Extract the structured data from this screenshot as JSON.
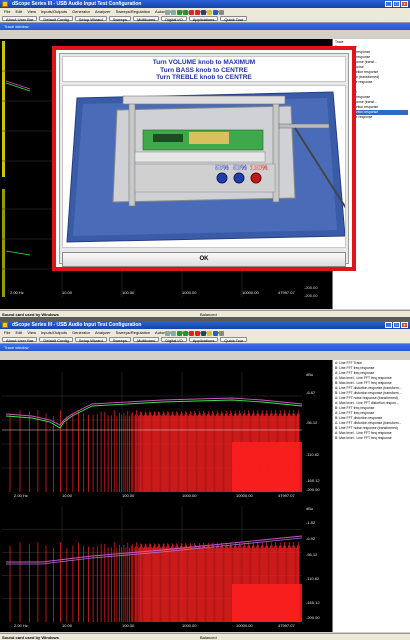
{
  "window_title": "dScope Series III - USB Audio Input Test Configuration",
  "menu": [
    "File",
    "Edit",
    "View",
    "Inputs/Outputs",
    "Generator",
    "Analyzer",
    "Sweeps/Regulation",
    "Automation",
    "Utility",
    "Window",
    "Help"
  ],
  "toolbar_buttons": [
    "About User Bar",
    "Default Config",
    "Setup Wizard",
    "Sweeps",
    "Multitones",
    "Digital I/O",
    "Applications",
    "Quick Tour"
  ],
  "trace_window_title": "Trace window",
  "dialog": {
    "instructions": [
      "Turn VOLUME knob to MAXIMUM",
      "Turn BASS knob to CENTRE",
      "Turn TREBLE knob to CENTRE"
    ],
    "knob_labels": [
      "50%",
      "50%",
      "100%"
    ],
    "ok_label": "OK"
  },
  "status_text": "Sound card used by Windows",
  "status_middle": "Balanced",
  "legend_top": [
    "Trace",
    "Freq response",
    "Line FFT freq response",
    "Line FFT freq response",
    "distortion response (transf...",
    "distortion response",
    "Line FFT distortion response",
    "noise response (transformed)",
    "Line FFT noise response",
    "Trace",
    "Freq response",
    "Line FFT freq response",
    "distortion response (transf...",
    "Line FFT distortion response",
    "Line FFT distortion response",
    "Line FFT noise response"
  ],
  "legend_bottom": [
    "A: Line FFT Trace",
    "B: Line FFT freq response",
    "A: Line FFT freq response",
    "A: Max level - Line FFT freq response",
    "B: Max level - Line FFT freq response",
    "A: Line FFT distortion response (transform...",
    "B: Line FFT distortion response (transform...",
    "A: Line FFT noise response (transformed)",
    "A: Max level - Line FFT distortion respon...",
    "B: Line FFT freq response",
    "A: Line FFT freq response",
    "B: Line FFT distortion response",
    "A: Line FFT distortion response (transform...",
    "B: Line FFT noise response (transformed)",
    "A: Max level - Line FFT freq response",
    "B: Max level - Line FFT freq response"
  ],
  "top_xticks": [
    "2.00 Hz",
    "10.00",
    "100.00",
    "1000.00",
    "10000.00",
    "47997.07"
  ],
  "top_yticks": [
    "-200.00",
    "-200.00"
  ],
  "bottom_xticks": [
    "2.00 Hz",
    "10.00",
    "100.00",
    "1000.00",
    "10000.00",
    "47997.07"
  ],
  "bottom_yticks_top": [
    "dBu",
    "-6.87",
    "-56.12",
    "-110.62",
    "-165.12",
    "-200.00"
  ],
  "bottom_yticks_bottom": [
    "dBu",
    "-1.82",
    "-6.92",
    "-56.12",
    "-110.62",
    "-165.12",
    "-200.00"
  ],
  "pct": [
    "50%",
    "50%",
    "100%"
  ],
  "colors": {
    "accent": "#e1141b",
    "trace_red": "#ff2020",
    "trace_green": "#37e845",
    "trace_magenta": "#d054c8",
    "title_blue": "#1e32a8"
  }
}
